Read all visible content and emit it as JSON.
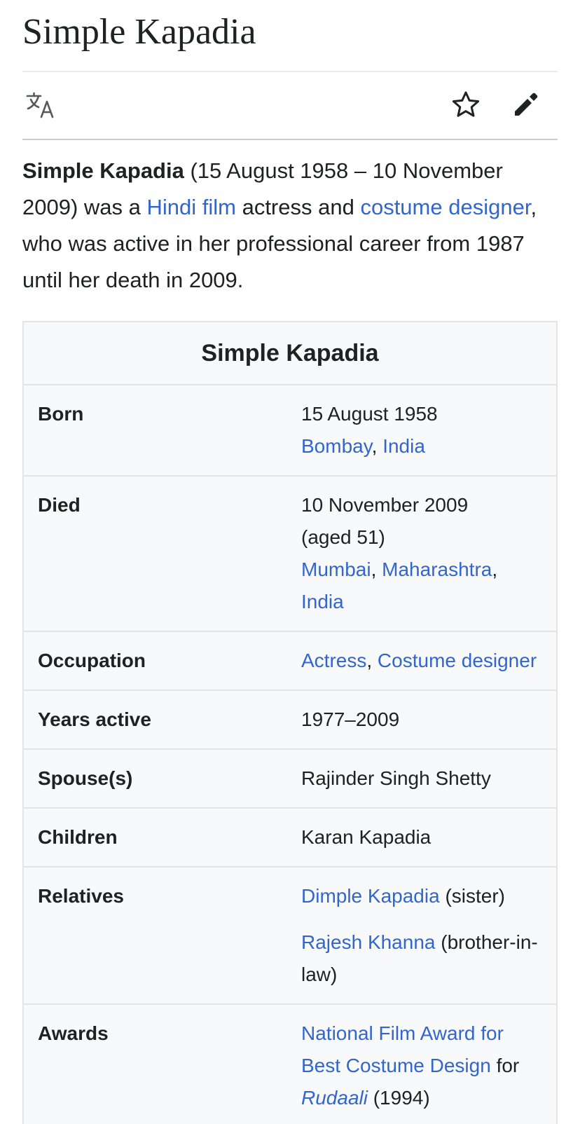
{
  "page": {
    "title": "Simple Kapadia"
  },
  "toolbar": {
    "language_icon": "translate-icon",
    "watch_icon": "star-icon",
    "edit_icon": "pencil-icon"
  },
  "intro": {
    "name": "Simple Kapadia",
    "t1": " (15 August 1958 – 10 November 2009) was a ",
    "link1": "Hindi film",
    "t2": " actress and ",
    "link2": "costume designer",
    "t3": ", who was active in her professional career from 1987 until her death in 2009."
  },
  "infobox": {
    "title": "Simple Kapadia",
    "born": {
      "label": "Born",
      "date": "15 August 1958",
      "place1": "Bombay",
      "sep": ", ",
      "place2": "India"
    },
    "died": {
      "label": "Died",
      "date": "10 November 2009",
      "age": "(aged 51)",
      "place1": "Mumbai",
      "sep1": ", ",
      "place2": "Maharashtra",
      "sep2": ",",
      "place3": "India"
    },
    "occupation": {
      "label": "Occupation",
      "item1": "Actress",
      "sep": ", ",
      "item2": "Costume designer"
    },
    "years_active": {
      "label": "Years active",
      "value": "1977–2009"
    },
    "spouse": {
      "label": "Spouse(s)",
      "value": "Rajinder Singh Shetty"
    },
    "children": {
      "label": "Children",
      "value": "Karan Kapadia"
    },
    "relatives": {
      "label": "Relatives",
      "rel1_name": "Dimple Kapadia",
      "rel1_note": " (sister)",
      "rel2_name": "Rajesh Khanna",
      "rel2_note": " (brother-in-law)"
    },
    "awards": {
      "label": "Awards",
      "award_link": "National Film Award for Best Costume Design",
      "for_text": " for ",
      "film": "Rudaali",
      "year": " (1994)"
    }
  },
  "colors": {
    "link": "#3366cc",
    "text": "#202122",
    "infobox_bg": "#f8f9fa"
  }
}
